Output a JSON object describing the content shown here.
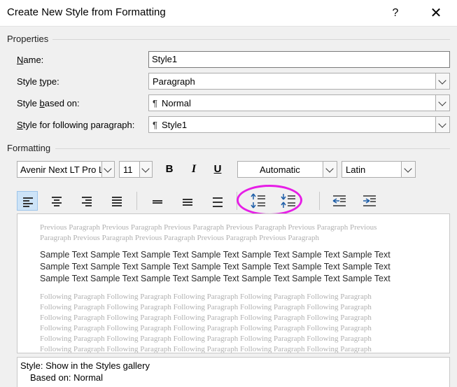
{
  "window": {
    "title": "Create New Style from Formatting",
    "help_label": "?",
    "close_label": "✕"
  },
  "properties": {
    "section_label": "Properties",
    "name_label_pre": "",
    "name_label_u": "N",
    "name_label_post": "ame:",
    "name_value": "Style1",
    "style_type_label_pre": "Style ",
    "style_type_label_u": "t",
    "style_type_label_post": "ype:",
    "style_type_value": "Paragraph",
    "based_on_label_pre": "Style ",
    "based_on_label_u": "b",
    "based_on_label_post": "ased on:",
    "based_on_value": "Normal",
    "following_label_pre": "",
    "following_label_u": "S",
    "following_label_post": "tyle for following paragraph:",
    "following_value": "Style1",
    "pilcrow": "¶"
  },
  "formatting": {
    "section_label": "Formatting",
    "font_name": "Avenir Next LT Pro L",
    "font_size": "11",
    "bold_label": "B",
    "italic_label": "I",
    "underline_label": "U",
    "color_value": "Automatic",
    "script_value": "Latin"
  },
  "preview": {
    "previous_lines": [
      "Previous Paragraph Previous Paragraph Previous Paragraph Previous Paragraph Previous Paragraph Previous",
      "Paragraph Previous Paragraph Previous Paragraph Previous Paragraph Previous Paragraph"
    ],
    "sample_lines": [
      "Sample Text Sample Text Sample Text Sample Text Sample Text Sample Text Sample Text",
      "Sample Text Sample Text Sample Text Sample Text Sample Text Sample Text Sample Text",
      "Sample Text Sample Text Sample Text Sample Text Sample Text Sample Text Sample Text"
    ],
    "following_lines": [
      "Following Paragraph Following Paragraph Following Paragraph Following Paragraph Following Paragraph",
      "Following Paragraph Following Paragraph Following Paragraph Following Paragraph Following Paragraph",
      "Following Paragraph Following Paragraph Following Paragraph Following Paragraph Following Paragraph",
      "Following Paragraph Following Paragraph Following Paragraph Following Paragraph Following Paragraph",
      "Following Paragraph Following Paragraph Following Paragraph Following Paragraph Following Paragraph",
      "Following Paragraph Following Paragraph Following Paragraph Following Paragraph Following Paragraph"
    ]
  },
  "description": {
    "line1": "Style: Show in the Styles gallery",
    "line2": "Based on: Normal"
  },
  "colors": {
    "highlight": "#e61ee6",
    "selected_bg": "#cde3f7"
  }
}
